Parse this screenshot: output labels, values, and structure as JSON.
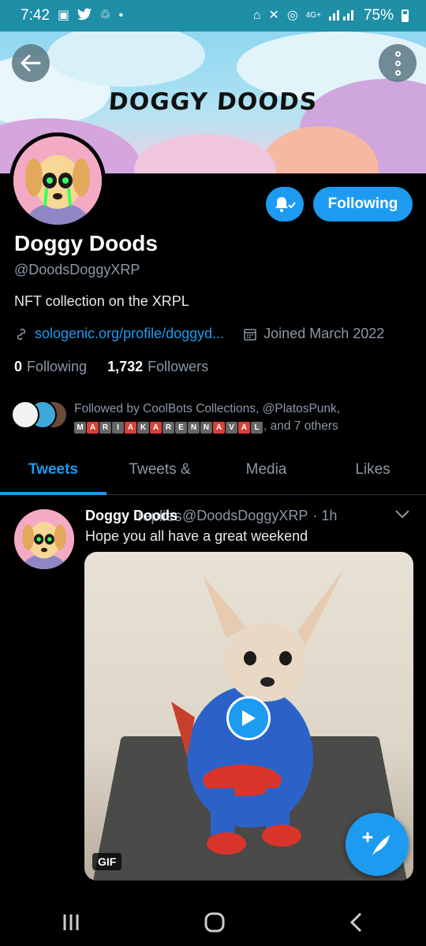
{
  "status_bar": {
    "time": "7:42",
    "network": "4G+",
    "battery": "75%"
  },
  "banner": {
    "title": "DOGGY DOODS"
  },
  "profile": {
    "name": "Doggy Doods",
    "handle": "@DoodsDoggyXRP",
    "bio": "NFT collection on the XRPL",
    "link": "sologenic.org/profile/doggyd...",
    "joined": "Joined March 2022",
    "following_count": "0",
    "following_label": "Following",
    "followers_count": "1,732",
    "followers_label": "Followers",
    "follow_button": "Following",
    "followed_by_prefix": "Followed by CoolBots Collections, @PlatosPunk,",
    "followed_by_tiles": [
      {
        "letter": "M",
        "red": false
      },
      {
        "letter": "A",
        "red": true
      },
      {
        "letter": "R",
        "red": false
      },
      {
        "letter": "I",
        "red": false
      },
      {
        "letter": "A",
        "red": true
      },
      {
        "letter": "K",
        "red": false
      },
      {
        "letter": "A",
        "red": true
      },
      {
        "letter": "R",
        "red": false
      },
      {
        "letter": "E",
        "red": false
      },
      {
        "letter": "N",
        "red": false
      },
      {
        "letter": "N",
        "red": false
      },
      {
        "letter": "A",
        "red": true
      },
      {
        "letter": "V",
        "red": false
      },
      {
        "letter": "A",
        "red": true
      },
      {
        "letter": "L",
        "red": false
      }
    ],
    "followed_by_suffix": ", and 7 others"
  },
  "tabs": [
    {
      "label": "Tweets",
      "active": true
    },
    {
      "label": "Tweets & replies",
      "active": false
    },
    {
      "label": "Media",
      "active": false
    },
    {
      "label": "Likes",
      "active": false
    }
  ],
  "tweet": {
    "author": "Doggy Doods",
    "handle": "@DoodsDoggyXRP",
    "time": "· 1h",
    "text": "Hope you all have a great weekend",
    "media_badge": "GIF"
  },
  "colors": {
    "accent": "#1d9bf0",
    "status_bar": "#1f8fa8",
    "avatar_bg": "#f4a9c4"
  },
  "icons": {
    "back": "arrow-left",
    "more": "vertical-dots",
    "notifications": "bell-check",
    "link": "link",
    "calendar": "calendar",
    "compose": "feather-plus",
    "play": "play"
  }
}
